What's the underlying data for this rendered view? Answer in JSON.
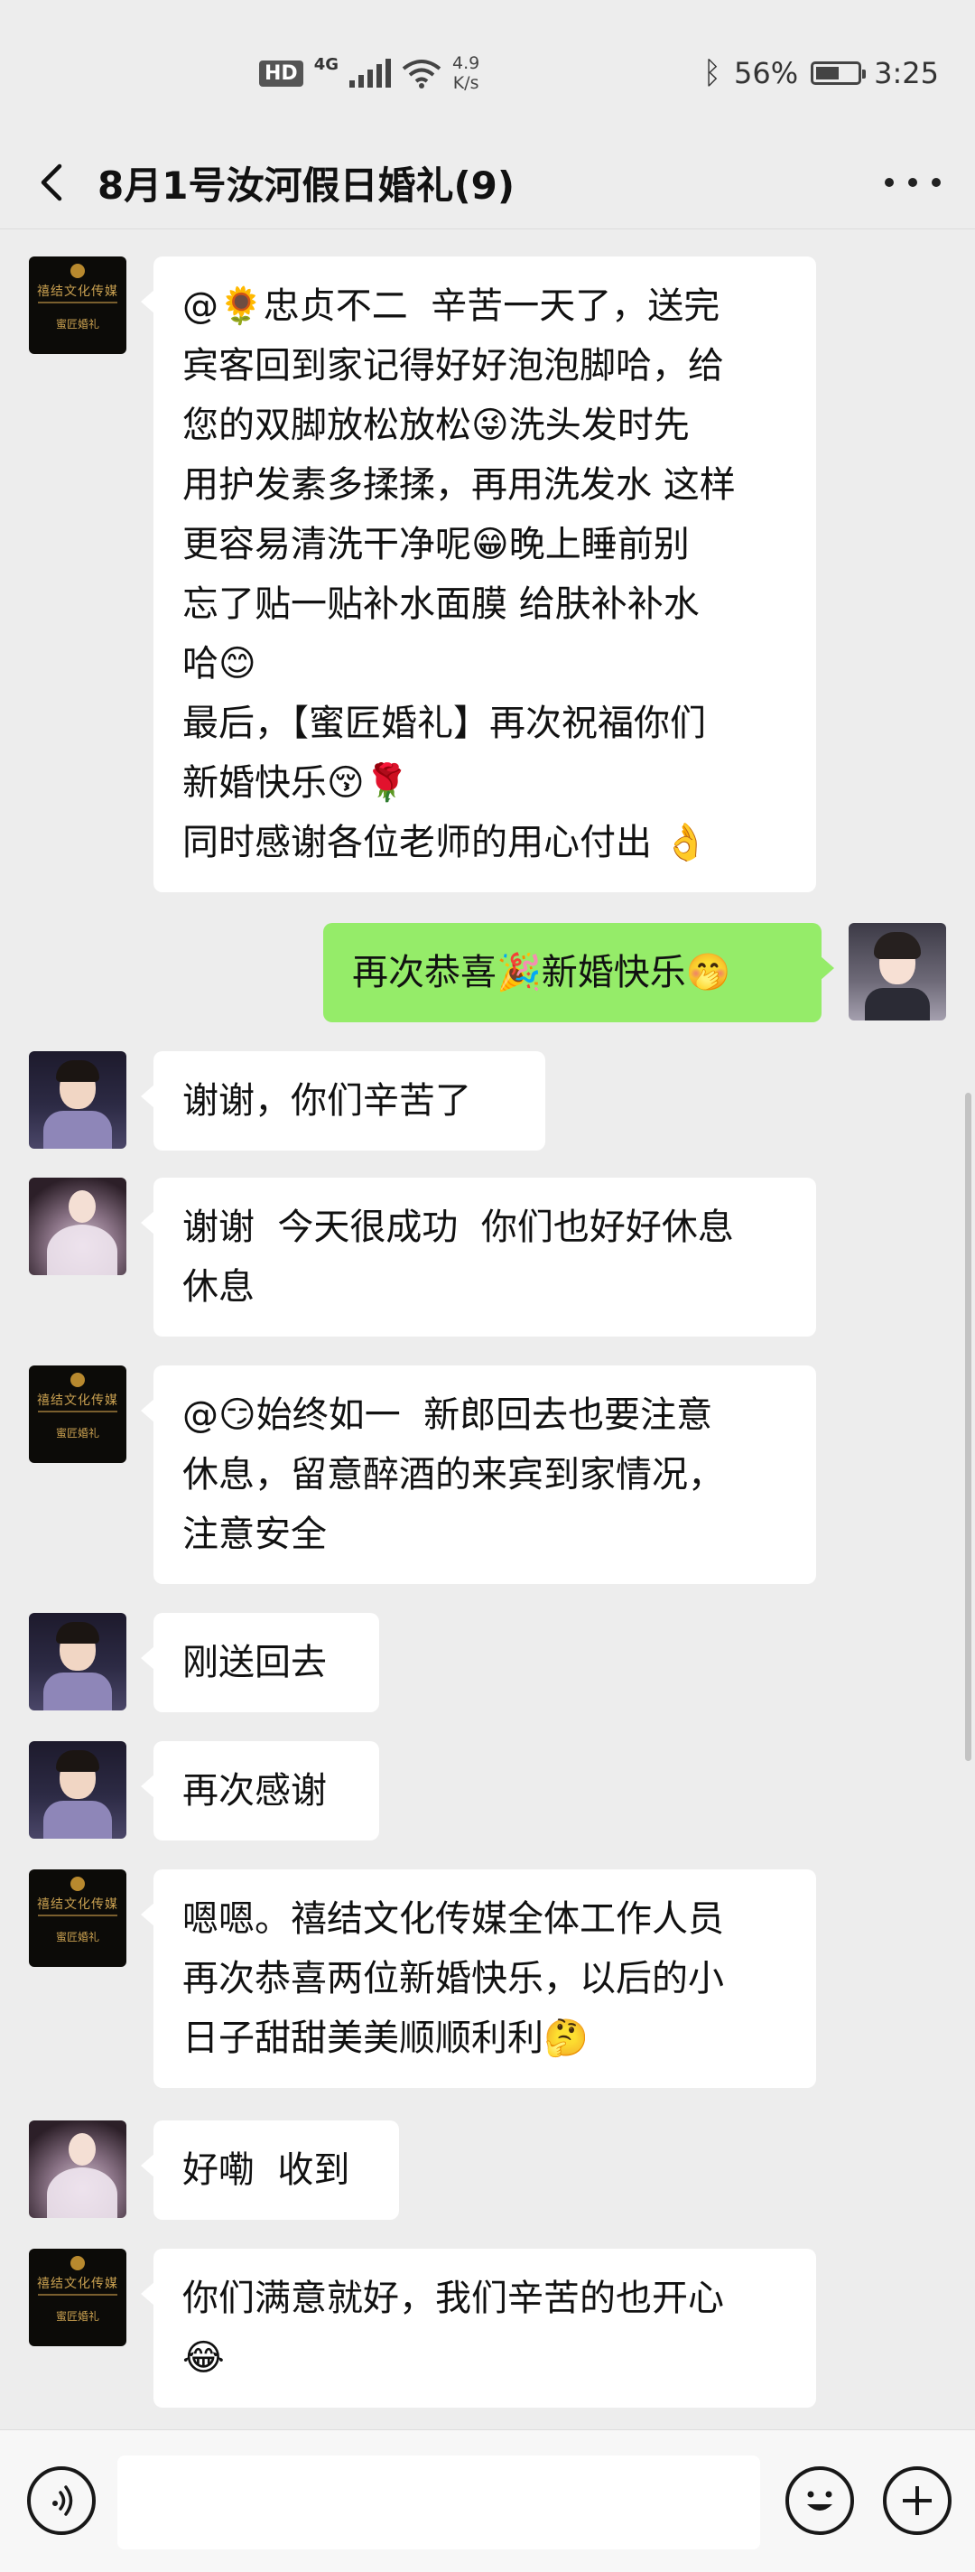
{
  "status_bar": {
    "hd": "HD",
    "network": "4G",
    "speed_value": "4.9",
    "speed_unit": "K/s",
    "battery_percent": "56%",
    "battery_level": 0.56,
    "time": "3:25"
  },
  "header": {
    "title": "8月1号汝河假日婚礼(9)"
  },
  "messages": [
    {
      "side": "in",
      "avatar": "brand-logo",
      "lines": [
        "@🌻忠贞不二  辛苦一天了，送完",
        "宾客回到家记得好好泡泡脚哈，给",
        "您的双脚放松放松😜洗头发时先",
        "用护发素多揉揉，再用洗发水 这样",
        "更容易清洗干净呢😁晚上睡前别",
        "忘了贴一贴补水面膜 给肤补补水",
        "哈😊",
        "最后，【蜜匠婚礼】再次祝福你们",
        "新婚快乐😚🌹",
        "同时感谢各位老师的用心付出 👌"
      ]
    },
    {
      "side": "out",
      "avatar": "self",
      "lines": [
        "再次恭喜🎉新婚快乐🤭"
      ]
    },
    {
      "side": "in",
      "avatar": "groom",
      "lines": [
        "谢谢，你们辛苦了"
      ]
    },
    {
      "side": "in",
      "avatar": "bride",
      "lines": [
        "谢谢  今天很成功  你们也好好休息",
        "休息"
      ]
    },
    {
      "side": "in",
      "avatar": "brand-logo",
      "lines": [
        "@😏始终如一  新郎回去也要注意",
        "休息，留意醉酒的来宾到家情况，",
        "注意安全"
      ]
    },
    {
      "side": "in",
      "avatar": "groom",
      "lines": [
        "刚送回去"
      ]
    },
    {
      "side": "in",
      "avatar": "groom",
      "lines": [
        "再次感谢"
      ]
    },
    {
      "side": "in",
      "avatar": "brand-logo",
      "lines": [
        "嗯嗯。禧结文化传媒全体工作人员",
        "再次恭喜两位新婚快乐，以后的小",
        "日子甜甜美美顺顺利利🤔"
      ]
    },
    {
      "side": "in",
      "avatar": "bride",
      "lines": [
        "好嘞  收到"
      ]
    },
    {
      "side": "in",
      "avatar": "brand-logo",
      "lines": [
        "你们满意就好，我们辛苦的也开心",
        "😂"
      ]
    }
  ],
  "input": {
    "value": "",
    "placeholder": ""
  },
  "icons": {
    "back": "chevron-left-icon",
    "more": "more-dots-icon",
    "voice": "voice-icon",
    "emoji": "emoji-icon",
    "plus": "plus-icon"
  },
  "colors": {
    "background": "#ededed",
    "incoming_bubble": "#ffffff",
    "outgoing_bubble": "#95ec69"
  }
}
